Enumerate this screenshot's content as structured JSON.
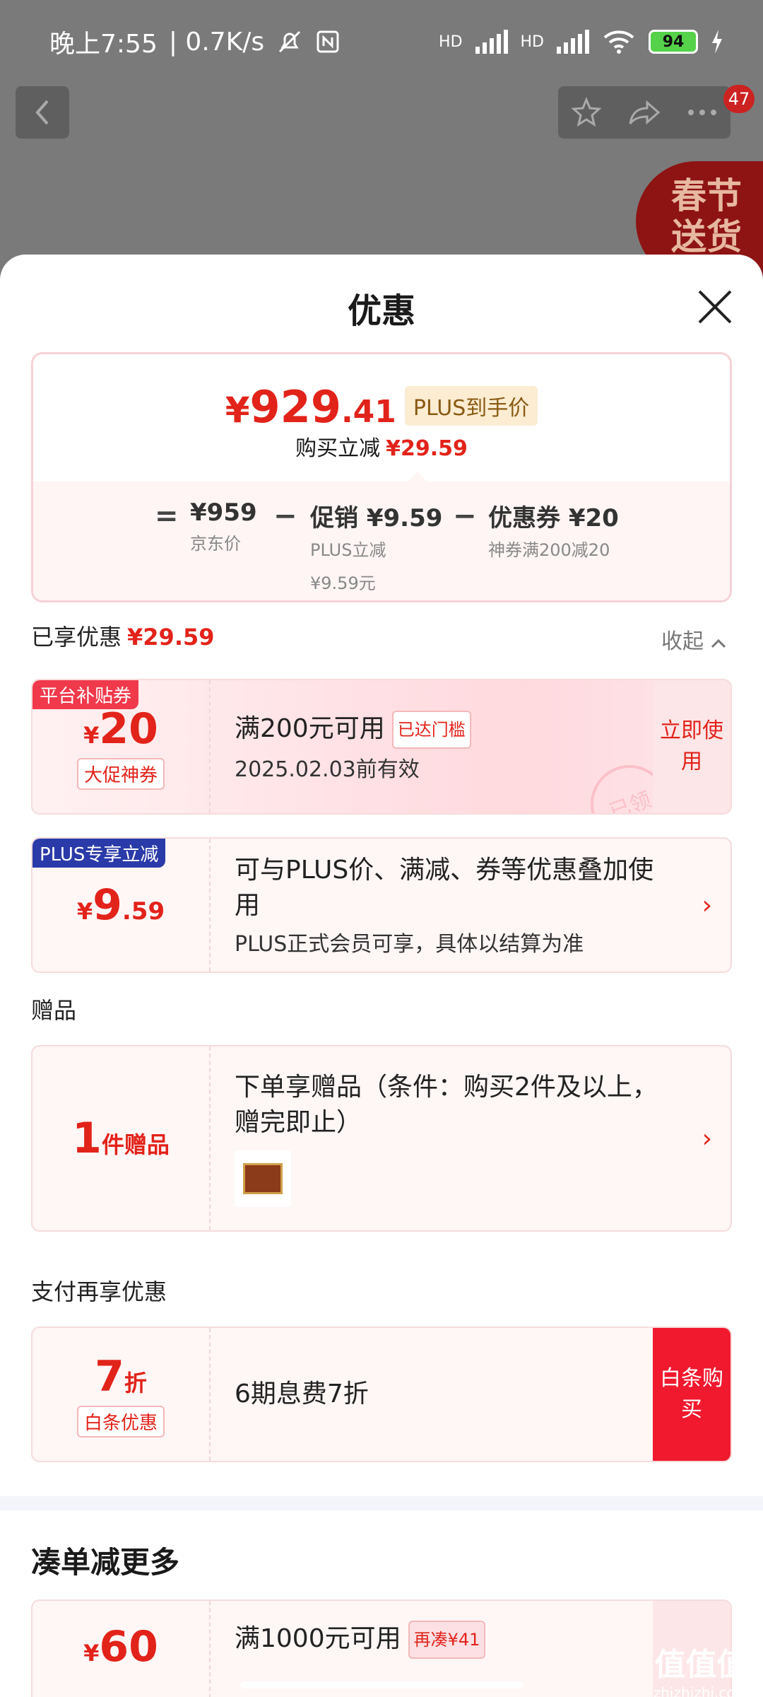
{
  "status_bar": {
    "time": "晚上7:55",
    "speed": "| 0.7K/s",
    "battery": "94"
  },
  "nav": {
    "badge_count": "47"
  },
  "banner": {
    "line1": "春节",
    "line2": "送货"
  },
  "sheet": {
    "title": "优惠",
    "price_card": {
      "currency": "¥",
      "price_int": "929",
      "price_dec": ".41",
      "plus_tag": "PLUS到手价",
      "instant_label": "购买立减",
      "instant_value": "¥29.59",
      "eq": "=",
      "minus": "−",
      "jd_price": "¥959",
      "jd_label": "京东价",
      "promo_value": "促销 ¥9.59",
      "promo_label": "PLUS立减",
      "promo_sub": "¥9.59元",
      "coupon_value": "优惠券 ¥20",
      "coupon_label": "神券满200减20"
    },
    "enjoyed": {
      "label": "已享优惠",
      "value": "¥29.59",
      "collapse": "收起"
    },
    "coupons": [
      {
        "corner": "平台补贴券",
        "currency": "¥",
        "amount": "20",
        "tag": "大促神券",
        "title": "满200元可用",
        "status": "已达门槛",
        "expiry": "2025.02.03前有效",
        "action": "立即使用",
        "stamp": "已领"
      },
      {
        "corner": "PLUS专享立减",
        "currency": "¥",
        "amount": "9",
        "amount_dec": ".59",
        "title": "可与PLUS价、满减、券等优惠叠加使用",
        "sub": "PLUS正式会员可享，具体以结算为准"
      }
    ],
    "gift": {
      "section": "赠品",
      "count": "1",
      "unit": "件赠品",
      "title": "下单享赠品（条件：购买2件及以上，赠完即止）"
    },
    "pay": {
      "section": "支付再享优惠",
      "amount": "7",
      "unit": "折",
      "tag": "白条优惠",
      "title": "6期息费7折",
      "action": "白条购买"
    },
    "more": {
      "section": "凑单减更多",
      "currency": "¥",
      "amount": "60",
      "title": "满1000元可用",
      "status": "再凑¥41"
    }
  },
  "watermark": {
    "line1": "值值值",
    "line2": "zhizhizhi.com"
  }
}
